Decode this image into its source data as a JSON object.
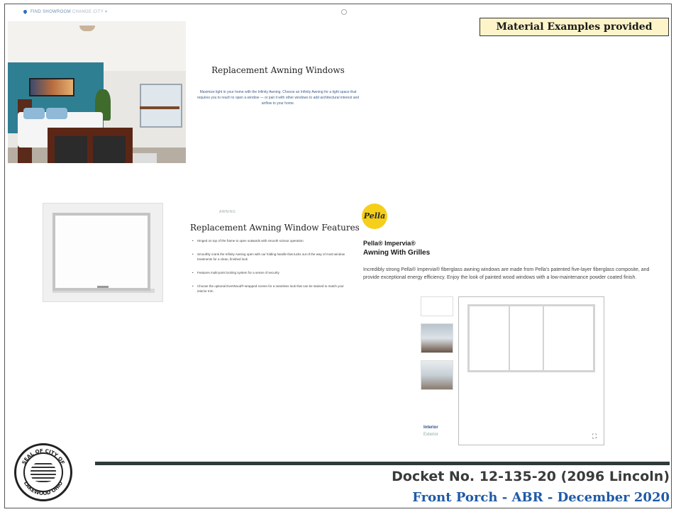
{
  "header": {
    "location_primary": "FIND SHOWROOM",
    "location_secondary": "CHANGE CITY ▾"
  },
  "material_label": "Material Examples provided",
  "awning_section": {
    "title": "Replacement Awning Windows",
    "description": "Maximize light in your home with the Infinity Awning. Choose an Infinity Awning for a tight space that requires you to reach to open a window — or pair it with other windows to add architectural interest and airflow to your home."
  },
  "features_section": {
    "kicker": "AWNING",
    "title": "Replacement Awning Window Features",
    "items": [
      "Hinged on top of the frame to open outwards with smooth scissor operation",
      "Smoothly crank the Infinity Awning open with our folding handle that tucks out of the way of most window treatments for a clean, finished look",
      "Features multi-point locking system for a sense of security",
      "Choose the optional EverWood®-wrapped screen for a seamless look that can be stained to match your interior trim"
    ]
  },
  "pella": {
    "logo_text": "Pella",
    "product_name": "Pella® Impervia®",
    "product_subtitle": "Awning With Grilles",
    "description": "Incredibly strong Pella® Impervia® fiberglass awning windows are made from Pella's patented five-layer fiberglass composite, and provide exceptional energy efficiency. Enjoy the look of painted wood windows with a low-maintenance powder coated finish.",
    "interior_label": "Interior",
    "exterior_label": "Exterior",
    "expand_glyph": "⛶"
  },
  "seal": {
    "text_top": "SEAL OF CITY OF",
    "text_bottom": "LAKEWOOD OHIO"
  },
  "footer": {
    "docket": "Docket No. 12-135-20 (2096 Lincoln)",
    "subtitle": "Front Porch - ABR - December 2020"
  }
}
